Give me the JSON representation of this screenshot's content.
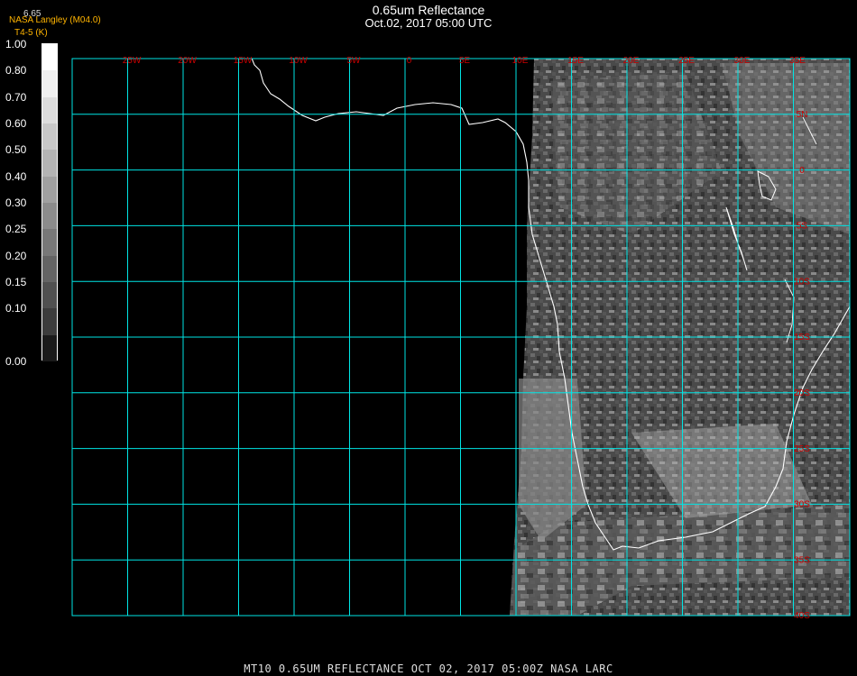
{
  "header": {
    "title": "0.65um Reflectance",
    "subtitle": "Oct.02, 2017 05:00 UTC",
    "agency": "NASA Langley (M04.0)",
    "temp_label": "T4-5 (K)",
    "tiny_value": "6.65"
  },
  "colorbar": {
    "labels": [
      "1.00",
      "0.80",
      "0.70",
      "0.60",
      "0.50",
      "0.40",
      "0.30",
      "0.25",
      "0.20",
      "0.15",
      "0.10",
      "0.00"
    ],
    "colors": [
      "#ffffff",
      "#f0f0f0",
      "#dddddd",
      "#c8c8c8",
      "#b4b4b4",
      "#a0a0a0",
      "#8c8c8c",
      "#787878",
      "#646464",
      "#505050",
      "#3c3c3c",
      "#1a1a1a"
    ]
  },
  "map": {
    "lon_labels": [
      "25W",
      "20W",
      "15W",
      "10W",
      "5W",
      "0",
      "5E",
      "10E",
      "15E",
      "20E",
      "25E",
      "30E",
      "35E"
    ],
    "lat_labels": [
      "5N",
      "0",
      "5S",
      "10S",
      "15S",
      "20S",
      "25S",
      "30S",
      "35S",
      "40S"
    ],
    "grid_color": "#00e5e5",
    "label_color": "#cc0000"
  },
  "footer": {
    "text": "MT10  0.65UM REFLECTANCE   OCT 02, 2017 05:00Z   NASA LARC"
  }
}
